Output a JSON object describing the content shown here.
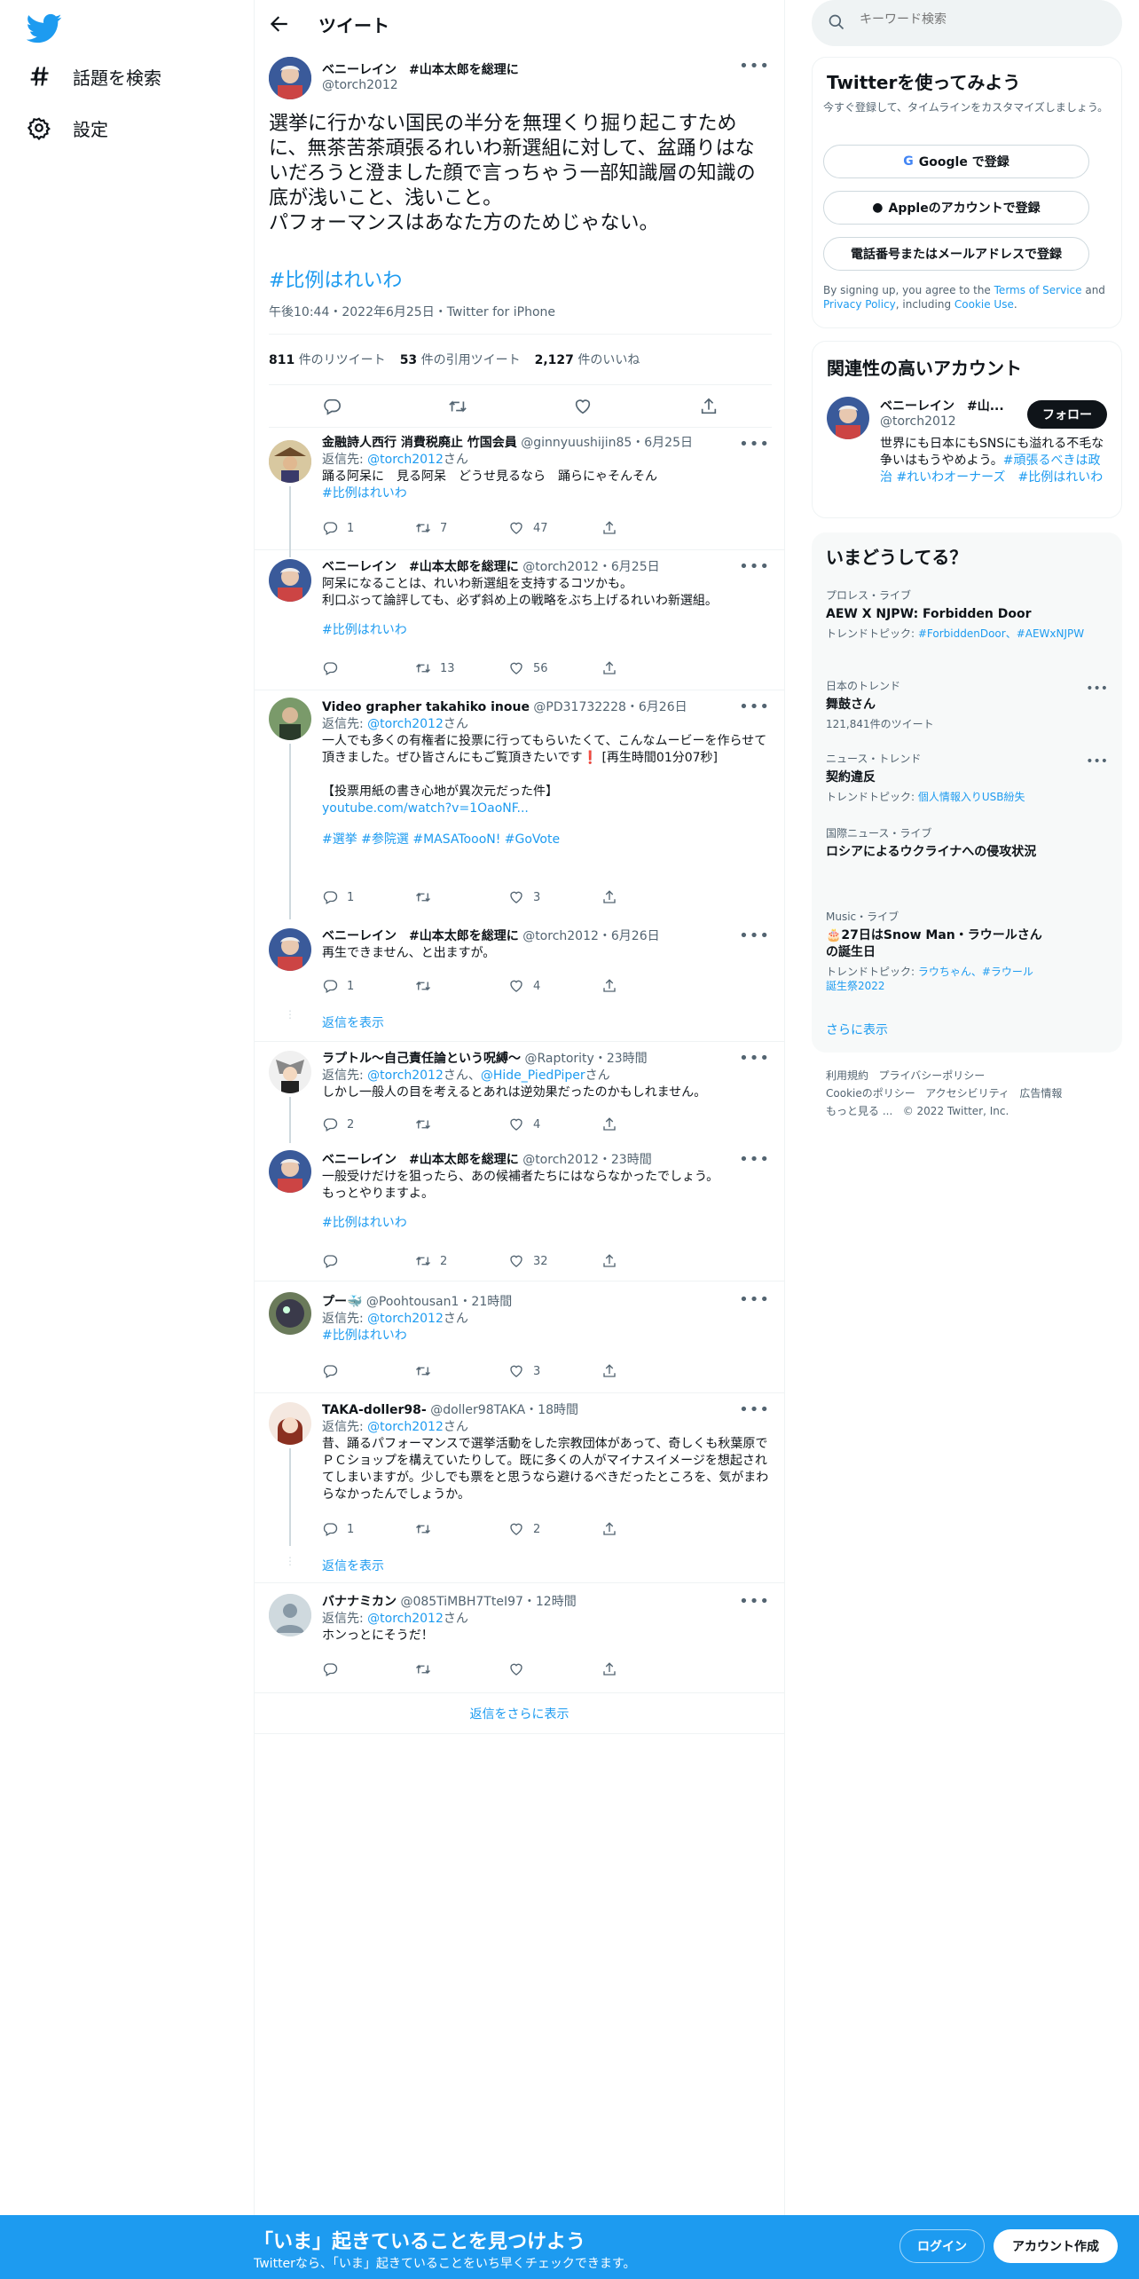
{
  "nav": {
    "explore_label": "話題を検索",
    "settings_label": "設定"
  },
  "header": {
    "title": "ツイート"
  },
  "main_tweet": {
    "name": "ベニーレイン　#山本太郎を総理に",
    "handle": "@torch2012",
    "text": "選挙に行かない国民の半分を無理くり掘り起こすために、無茶苦茶頑張るれいわ新選組に対して、盆踊りはないだろうと澄ました顔で言っちゃう一部知識層の知識の底が浅いこと、浅いこと。\nパフォーマンスはあなた方のためじゃない。",
    "hashtag": "#比例はれいわ",
    "meta": "午後10:44・2022年6月25日・Twitter for iPhone",
    "retweets_count": "811",
    "retweets_label": "件のリツイート",
    "quotes_count": "53",
    "quotes_label": "件の引用ツイート",
    "likes_count": "2,127",
    "likes_label": "件のいいね"
  },
  "replies": [
    {
      "name": "金融詩人西行 消費税廃止 竹国会員",
      "meta": "@ginnyuushijin85・6月25日",
      "reply_prefix": "返信先: ",
      "reply_to": "@torch2012",
      "reply_suffix": "さん",
      "text": "踊る阿呆に　見る阿呆　どうせ見るなら　踊らにゃそんそん",
      "link": "#比例はれいわ",
      "replies": "1",
      "retweets": "7",
      "likes": "47"
    },
    {
      "name": "ベニーレイン　#山本太郎を総理に",
      "meta": "@torch2012・6月25日",
      "text": "阿呆になることは、れいわ新選組を支持するコツかも。\n利口ぶって論評しても、必ず斜め上の戦略をぶち上げるれいわ新選組。",
      "link": "#比例はれいわ",
      "replies": "",
      "retweets": "13",
      "likes": "56"
    },
    {
      "name": "Video grapher takahiko inoue",
      "meta": "@PD31732228・6月26日",
      "reply_prefix": "返信先: ",
      "reply_to": "@torch2012",
      "reply_suffix": "さん",
      "text": "一人でも多くの有権者に投票に行ってもらいたくて、こんなムービーを作らせて頂きました。ぜひ皆さんにもご覧頂きたいです❗️ [再生時間01分07秒]\n\n【投票用紙の書き心地が異次元だった件】",
      "link": "youtube.com/watch?v=1OaoNF...",
      "tags": "#選挙 #参院選 #MASAToooN! #GoVote",
      "replies": "1",
      "retweets": "",
      "likes": "3"
    },
    {
      "name": "ベニーレイン　#山本太郎を総理に",
      "meta": "@torch2012・6月26日",
      "text": "再生できません、と出ますが。",
      "replies": "1",
      "retweets": "",
      "likes": "4"
    },
    {
      "name": "ラプトル〜自己責任論という呪縛〜",
      "meta": "@Raptority・23時間",
      "reply_prefix": "返信先: ",
      "reply_to": "@torch2012",
      "reply_sep": "さん、",
      "reply_to2": "@Hide_PiedPiper",
      "reply_suffix": "さん",
      "text": "しかし一般人の目を考えるとあれは逆効果だったのかもしれません。",
      "replies": "2",
      "retweets": "",
      "likes": "4"
    },
    {
      "name": "ベニーレイン　#山本太郎を総理に",
      "meta": "@torch2012・23時間",
      "text": "一般受けだけを狙ったら、あの候補者たちにはならなかったでしょう。\nもっとやりますよ。",
      "link": "#比例はれいわ",
      "replies": "",
      "retweets": "2",
      "likes": "32"
    },
    {
      "name": "プー🐳",
      "meta": "@Poohtousan1・21時間",
      "reply_prefix": "返信先: ",
      "reply_to": "@torch2012",
      "reply_suffix": "さん",
      "link": "#比例はれいわ",
      "replies": "",
      "retweets": "",
      "likes": "3"
    },
    {
      "name": "TAKA-doller98-",
      "meta": "@doller98TAKA・18時間",
      "reply_prefix": "返信先: ",
      "reply_to": "@torch2012",
      "reply_suffix": "さん",
      "text": "昔、踊るパフォーマンスで選挙活動をした宗教団体があって、奇しくも秋葉原でＰＣショップを構えていたりして。既に多くの人がマイナスイメージを想起されてしまいますが。少しでも票をと思うなら避けるべきだったところを、気がまわらなかったんでしょうか。",
      "replies": "1",
      "retweets": "",
      "likes": "2"
    },
    {
      "name": "バナナミカン",
      "meta": "@085TiMBH7TteI97・12時間",
      "reply_prefix": "返信先: ",
      "reply_to": "@torch2012",
      "reply_suffix": "さん",
      "text": "ホンっとにそうだ！",
      "replies": "",
      "retweets": "",
      "likes": ""
    }
  ],
  "show_replies_label": "返信を表示",
  "show_more_replies_label": "返信をさらに表示",
  "sidebar": {
    "search_placeholder": "キーワード検索",
    "signup_title": "Twitterを使ってみよう",
    "signup_sub": "今すぐ登録して、タイムラインをカスタマイズしましょう。",
    "google_btn": "Google で登録",
    "apple_btn": "Appleのアカウントで登録",
    "phone_btn": "電話番号またはメールアドレスで登録",
    "terms_pre": "By signing up, you agree to the ",
    "terms_link": "Terms of Service",
    "terms_and": " and ",
    "privacy_link": "Privacy Policy",
    "terms_incl": ", including ",
    "cookie_link": "Cookie Use",
    "terms_end": ".",
    "related_title": "関連性の高いアカウント",
    "related_name": "ベニーレイン　#山...",
    "related_handle": "@torch2012",
    "follow_label": "フォロー",
    "related_bio": "世界にも日本にもSNSにも溢れる不毛な争いはもうやめよう。",
    "related_bio_tags": "#頑張るべきは政治 #れいわオーナーズ　#比例はれいわ",
    "trends_title": "いまどうしてる？",
    "trends": [
      {
        "cat": "プロレス・ライブ",
        "title": "AEW X NJPW: Forbidden Door",
        "sub_label": "トレンドトピック: ",
        "sub_links": "#ForbiddenDoor、#AEWxNJPW"
      },
      {
        "cat": "日本のトレンド",
        "title": "舞鼓さん",
        "sub": "121,841件のツイート"
      },
      {
        "cat": "ニュース・トレンド",
        "title": "契約違反",
        "sub_label": "トレンドトピック: ",
        "sub_links": "個人情報入りUSB紛失"
      },
      {
        "cat": "国際ニュース・ライブ",
        "title": "ロシアによるウクライナへの侵攻状況"
      },
      {
        "cat": "Music・ライブ",
        "title": "🎂27日はSnow Man・ラウールさんの誕生日",
        "sub_label": "トレンドトピック: ",
        "sub_links": "ラウちゃん、#ラウール誕生祭2022"
      }
    ],
    "show_more": "さらに表示",
    "footer": [
      "利用規約",
      "プライバシーポリシー",
      "Cookieのポリシー",
      "アクセシビリティ",
      "広告情報",
      "もっと見る ...",
      "© 2022 Twitter, Inc."
    ]
  },
  "bottom": {
    "title": "「いま」起きていることを見つけよう",
    "sub": "Twitterなら、「いま」起きていることをいち早くチェックできます。",
    "login": "ログイン",
    "signup": "アカウント作成"
  },
  "colors": {
    "accent": "#1d9bf0",
    "text": "#0f1419",
    "muted": "#536471"
  }
}
